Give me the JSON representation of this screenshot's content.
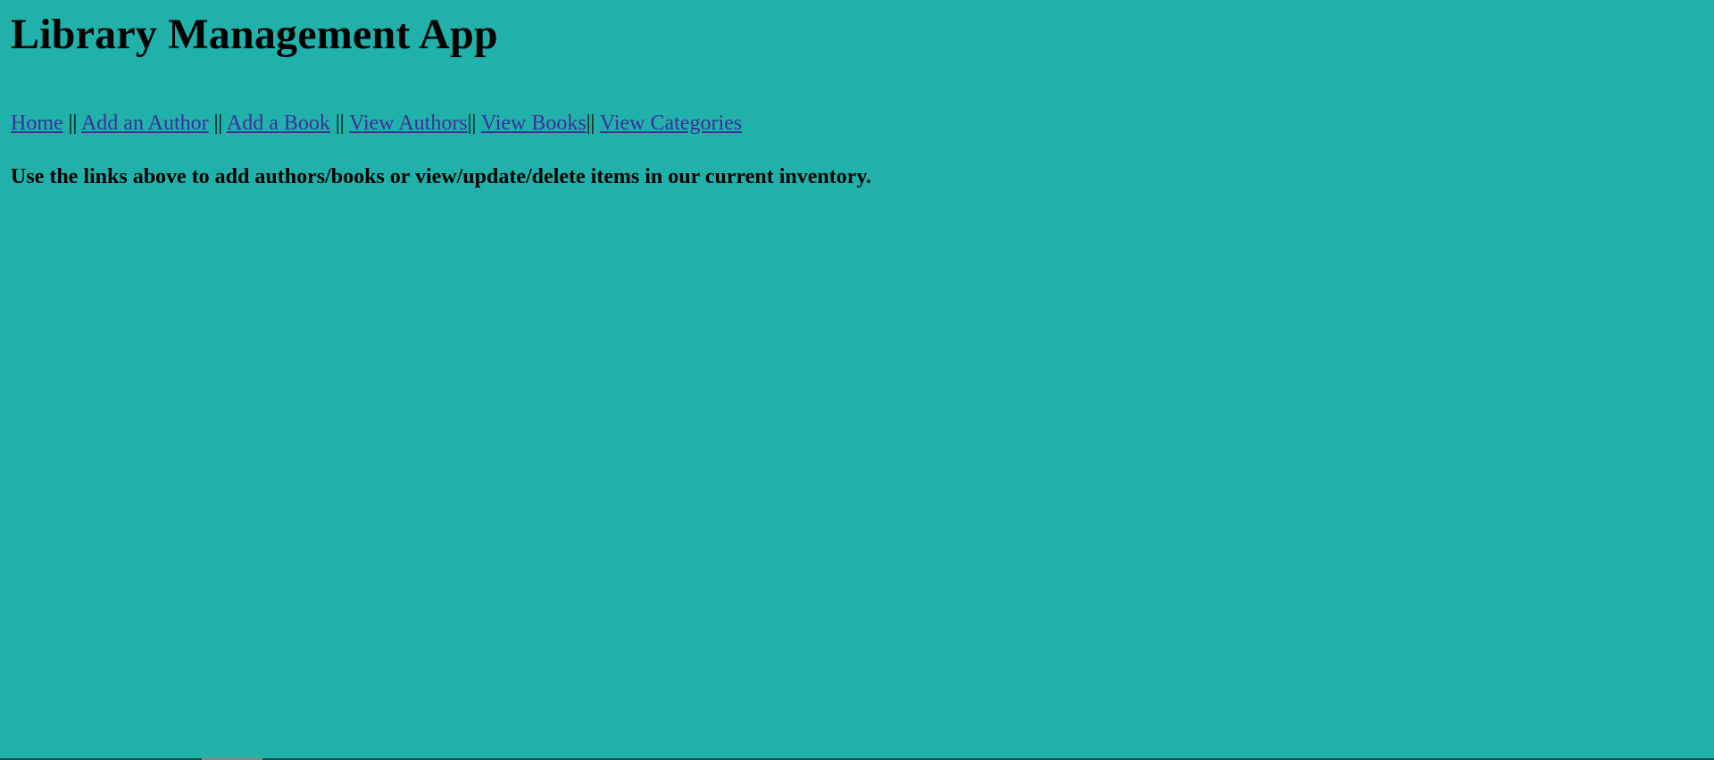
{
  "header": {
    "title": "Library Management App"
  },
  "nav": {
    "links": [
      {
        "label": "Home"
      },
      {
        "label": "Add an Author"
      },
      {
        "label": "Add a Book"
      },
      {
        "label": "View Authors"
      },
      {
        "label": "View Books"
      },
      {
        "label": "View Categories"
      }
    ],
    "separator": "||"
  },
  "main": {
    "message": "Use the links above to add authors/books or view/update/delete items in our current inventory."
  },
  "colors": {
    "background": "#20b2aa",
    "link": "#3d2f9a",
    "text": "#000000"
  }
}
